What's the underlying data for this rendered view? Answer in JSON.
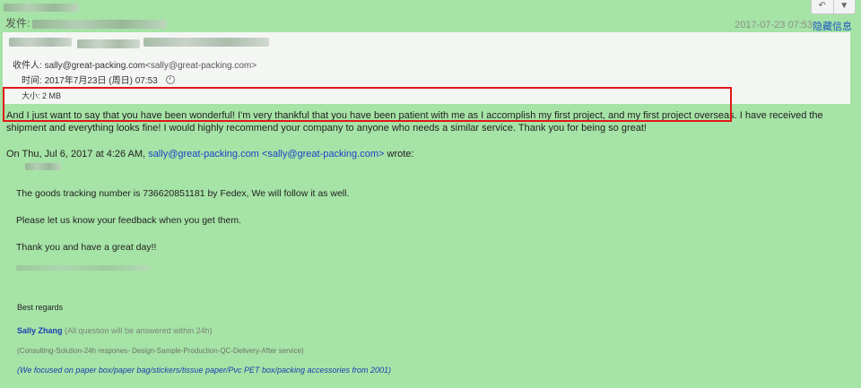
{
  "header": {
    "sender_prefix": "发件:",
    "date": "2017-07-23 07:53",
    "hide_info": "隐藏信息",
    "reply_icon": "reply-icon",
    "more_icon": "chevron-down-icon"
  },
  "details": {
    "recipient_label": "收件人:",
    "recipient_email": "sally@great-packing.com",
    "recipient_full": "<sally@great-packing.com>",
    "time_label": "时间:",
    "time_value": "2017年7月23日 (周日) 07:53",
    "size_label": "大小:",
    "size_value": "2 MB"
  },
  "message": {
    "paragraph": "And I just want to say that you have been wonderful! I'm very thankful that you have been patient with me as I accomplish my first project, and my first project overseas. I have received the shipment and everything looks fine! I would highly recommend your company to anyone who needs a similar service. Thank you for being so great!",
    "on_prefix": "On Thu, Jul 6, 2017 at 4:26 AM,",
    "on_email": "sally@great-packing.com",
    "on_email_brackets": "<sally@great-packing.com>",
    "on_suffix": "wrote:"
  },
  "quote": {
    "line1": "The goods tracking number is 736620851181 by Fedex, We will follow it as well.",
    "line2": "Please let us know your feedback when you get them.",
    "line3": "Thank you and have a great day!!",
    "best_regards": "Best regards",
    "sig_name": "Sally Zhang",
    "sig_note": "(All question will be answered within 24h)",
    "consulting": "(Consulting-Solution-24h respones- Design-Sample-Production-QC-Delivery-After service)",
    "focus": "(We focused on paper box/paper bag/stickers/tissue paper/Pvc PET box/packing accessories from 2001)"
  }
}
